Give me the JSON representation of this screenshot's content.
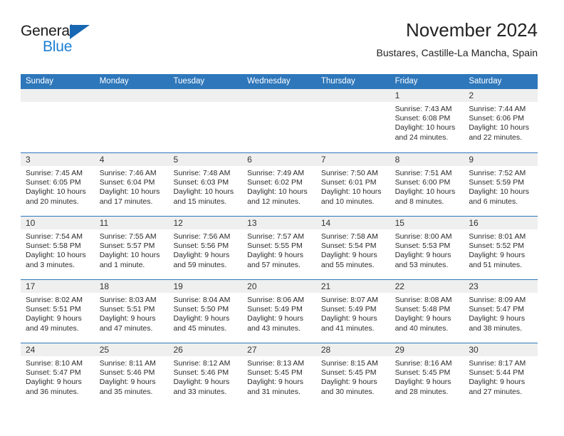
{
  "logo": {
    "word_one": "General",
    "word_two": "Blue",
    "triangle": "blue-triangle-icon"
  },
  "header": {
    "title": "November 2024",
    "subtitle": "Bustares, Castille-La Mancha, Spain"
  },
  "colors": {
    "header_blue": "#2e77bb",
    "day_band_gray": "#efefef",
    "logo_blue": "#1b7fd4",
    "text": "#222222"
  },
  "weekdays": [
    "Sunday",
    "Monday",
    "Tuesday",
    "Wednesday",
    "Thursday",
    "Friday",
    "Saturday"
  ],
  "weeks": [
    [
      {
        "day": "",
        "empty": true,
        "sunrise": "",
        "sunset": "",
        "daylight_line1": "",
        "daylight_line2": ""
      },
      {
        "day": "",
        "empty": true,
        "sunrise": "",
        "sunset": "",
        "daylight_line1": "",
        "daylight_line2": ""
      },
      {
        "day": "",
        "empty": true,
        "sunrise": "",
        "sunset": "",
        "daylight_line1": "",
        "daylight_line2": ""
      },
      {
        "day": "",
        "empty": true,
        "sunrise": "",
        "sunset": "",
        "daylight_line1": "",
        "daylight_line2": ""
      },
      {
        "day": "",
        "empty": true,
        "sunrise": "",
        "sunset": "",
        "daylight_line1": "",
        "daylight_line2": ""
      },
      {
        "day": "1",
        "empty": false,
        "sunrise": "Sunrise: 7:43 AM",
        "sunset": "Sunset: 6:08 PM",
        "daylight_line1": "Daylight: 10 hours",
        "daylight_line2": "and 24 minutes."
      },
      {
        "day": "2",
        "empty": false,
        "sunrise": "Sunrise: 7:44 AM",
        "sunset": "Sunset: 6:06 PM",
        "daylight_line1": "Daylight: 10 hours",
        "daylight_line2": "and 22 minutes."
      }
    ],
    [
      {
        "day": "3",
        "empty": false,
        "sunrise": "Sunrise: 7:45 AM",
        "sunset": "Sunset: 6:05 PM",
        "daylight_line1": "Daylight: 10 hours",
        "daylight_line2": "and 20 minutes."
      },
      {
        "day": "4",
        "empty": false,
        "sunrise": "Sunrise: 7:46 AM",
        "sunset": "Sunset: 6:04 PM",
        "daylight_line1": "Daylight: 10 hours",
        "daylight_line2": "and 17 minutes."
      },
      {
        "day": "5",
        "empty": false,
        "sunrise": "Sunrise: 7:48 AM",
        "sunset": "Sunset: 6:03 PM",
        "daylight_line1": "Daylight: 10 hours",
        "daylight_line2": "and 15 minutes."
      },
      {
        "day": "6",
        "empty": false,
        "sunrise": "Sunrise: 7:49 AM",
        "sunset": "Sunset: 6:02 PM",
        "daylight_line1": "Daylight: 10 hours",
        "daylight_line2": "and 12 minutes."
      },
      {
        "day": "7",
        "empty": false,
        "sunrise": "Sunrise: 7:50 AM",
        "sunset": "Sunset: 6:01 PM",
        "daylight_line1": "Daylight: 10 hours",
        "daylight_line2": "and 10 minutes."
      },
      {
        "day": "8",
        "empty": false,
        "sunrise": "Sunrise: 7:51 AM",
        "sunset": "Sunset: 6:00 PM",
        "daylight_line1": "Daylight: 10 hours",
        "daylight_line2": "and 8 minutes."
      },
      {
        "day": "9",
        "empty": false,
        "sunrise": "Sunrise: 7:52 AM",
        "sunset": "Sunset: 5:59 PM",
        "daylight_line1": "Daylight: 10 hours",
        "daylight_line2": "and 6 minutes."
      }
    ],
    [
      {
        "day": "10",
        "empty": false,
        "sunrise": "Sunrise: 7:54 AM",
        "sunset": "Sunset: 5:58 PM",
        "daylight_line1": "Daylight: 10 hours",
        "daylight_line2": "and 3 minutes."
      },
      {
        "day": "11",
        "empty": false,
        "sunrise": "Sunrise: 7:55 AM",
        "sunset": "Sunset: 5:57 PM",
        "daylight_line1": "Daylight: 10 hours",
        "daylight_line2": "and 1 minute."
      },
      {
        "day": "12",
        "empty": false,
        "sunrise": "Sunrise: 7:56 AM",
        "sunset": "Sunset: 5:56 PM",
        "daylight_line1": "Daylight: 9 hours",
        "daylight_line2": "and 59 minutes."
      },
      {
        "day": "13",
        "empty": false,
        "sunrise": "Sunrise: 7:57 AM",
        "sunset": "Sunset: 5:55 PM",
        "daylight_line1": "Daylight: 9 hours",
        "daylight_line2": "and 57 minutes."
      },
      {
        "day": "14",
        "empty": false,
        "sunrise": "Sunrise: 7:58 AM",
        "sunset": "Sunset: 5:54 PM",
        "daylight_line1": "Daylight: 9 hours",
        "daylight_line2": "and 55 minutes."
      },
      {
        "day": "15",
        "empty": false,
        "sunrise": "Sunrise: 8:00 AM",
        "sunset": "Sunset: 5:53 PM",
        "daylight_line1": "Daylight: 9 hours",
        "daylight_line2": "and 53 minutes."
      },
      {
        "day": "16",
        "empty": false,
        "sunrise": "Sunrise: 8:01 AM",
        "sunset": "Sunset: 5:52 PM",
        "daylight_line1": "Daylight: 9 hours",
        "daylight_line2": "and 51 minutes."
      }
    ],
    [
      {
        "day": "17",
        "empty": false,
        "sunrise": "Sunrise: 8:02 AM",
        "sunset": "Sunset: 5:51 PM",
        "daylight_line1": "Daylight: 9 hours",
        "daylight_line2": "and 49 minutes."
      },
      {
        "day": "18",
        "empty": false,
        "sunrise": "Sunrise: 8:03 AM",
        "sunset": "Sunset: 5:51 PM",
        "daylight_line1": "Daylight: 9 hours",
        "daylight_line2": "and 47 minutes."
      },
      {
        "day": "19",
        "empty": false,
        "sunrise": "Sunrise: 8:04 AM",
        "sunset": "Sunset: 5:50 PM",
        "daylight_line1": "Daylight: 9 hours",
        "daylight_line2": "and 45 minutes."
      },
      {
        "day": "20",
        "empty": false,
        "sunrise": "Sunrise: 8:06 AM",
        "sunset": "Sunset: 5:49 PM",
        "daylight_line1": "Daylight: 9 hours",
        "daylight_line2": "and 43 minutes."
      },
      {
        "day": "21",
        "empty": false,
        "sunrise": "Sunrise: 8:07 AM",
        "sunset": "Sunset: 5:49 PM",
        "daylight_line1": "Daylight: 9 hours",
        "daylight_line2": "and 41 minutes."
      },
      {
        "day": "22",
        "empty": false,
        "sunrise": "Sunrise: 8:08 AM",
        "sunset": "Sunset: 5:48 PM",
        "daylight_line1": "Daylight: 9 hours",
        "daylight_line2": "and 40 minutes."
      },
      {
        "day": "23",
        "empty": false,
        "sunrise": "Sunrise: 8:09 AM",
        "sunset": "Sunset: 5:47 PM",
        "daylight_line1": "Daylight: 9 hours",
        "daylight_line2": "and 38 minutes."
      }
    ],
    [
      {
        "day": "24",
        "empty": false,
        "sunrise": "Sunrise: 8:10 AM",
        "sunset": "Sunset: 5:47 PM",
        "daylight_line1": "Daylight: 9 hours",
        "daylight_line2": "and 36 minutes."
      },
      {
        "day": "25",
        "empty": false,
        "sunrise": "Sunrise: 8:11 AM",
        "sunset": "Sunset: 5:46 PM",
        "daylight_line1": "Daylight: 9 hours",
        "daylight_line2": "and 35 minutes."
      },
      {
        "day": "26",
        "empty": false,
        "sunrise": "Sunrise: 8:12 AM",
        "sunset": "Sunset: 5:46 PM",
        "daylight_line1": "Daylight: 9 hours",
        "daylight_line2": "and 33 minutes."
      },
      {
        "day": "27",
        "empty": false,
        "sunrise": "Sunrise: 8:13 AM",
        "sunset": "Sunset: 5:45 PM",
        "daylight_line1": "Daylight: 9 hours",
        "daylight_line2": "and 31 minutes."
      },
      {
        "day": "28",
        "empty": false,
        "sunrise": "Sunrise: 8:15 AM",
        "sunset": "Sunset: 5:45 PM",
        "daylight_line1": "Daylight: 9 hours",
        "daylight_line2": "and 30 minutes."
      },
      {
        "day": "29",
        "empty": false,
        "sunrise": "Sunrise: 8:16 AM",
        "sunset": "Sunset: 5:45 PM",
        "daylight_line1": "Daylight: 9 hours",
        "daylight_line2": "and 28 minutes."
      },
      {
        "day": "30",
        "empty": false,
        "sunrise": "Sunrise: 8:17 AM",
        "sunset": "Sunset: 5:44 PM",
        "daylight_line1": "Daylight: 9 hours",
        "daylight_line2": "and 27 minutes."
      }
    ]
  ]
}
